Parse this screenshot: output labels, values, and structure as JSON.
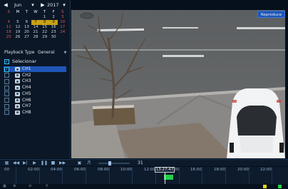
{
  "calendar": {
    "month": "Jun",
    "year": "2017",
    "weekdays": [
      "S",
      "M",
      "T",
      "W",
      "T",
      "F",
      "S"
    ],
    "weeks": [
      [
        "",
        "",
        "",
        "",
        "1",
        "2",
        "3"
      ],
      [
        "4",
        "5",
        "6",
        "7",
        "8",
        "9",
        "10"
      ],
      [
        "11",
        "12",
        "13",
        "14",
        "15",
        "16",
        "17"
      ],
      [
        "18",
        "19",
        "20",
        "21",
        "22",
        "23",
        "24"
      ],
      [
        "25",
        "26",
        "27",
        "28",
        "29",
        "30",
        ""
      ]
    ],
    "days_with_recordings": [
      "7",
      "8",
      "9"
    ]
  },
  "playback_type": {
    "label": "Playback Type",
    "value": "General"
  },
  "channels": {
    "select_all_label": "Selecionar",
    "items": [
      "CH1",
      "CH2",
      "CH3",
      "CH4",
      "CH5",
      "CH6",
      "CH7",
      "CH8"
    ],
    "checked": [
      "CH1"
    ],
    "selected": "CH1"
  },
  "video": {
    "status_badge": "Reproduce"
  },
  "controls": {
    "icons": [
      "layout-icon",
      "rewind-icon",
      "slow-icon",
      "play-icon",
      "pause-icon",
      "stop-icon",
      "fast-forward-icon",
      "snapshot-icon",
      "volume-icon"
    ],
    "zoom_label": "31"
  },
  "timeline": {
    "ticks": [
      "00",
      "02:00",
      "04:00",
      "06:00",
      "08:00",
      "10:00",
      "12:00",
      "14:00",
      "16:00",
      "18:00",
      "20:00",
      "22:00"
    ],
    "cursor_time": "13:27:47"
  },
  "colors": {
    "accent": "#1e56b7",
    "recording": "#23d04a",
    "motion": "#e7d21a",
    "calendar_record": "#c8a116"
  }
}
